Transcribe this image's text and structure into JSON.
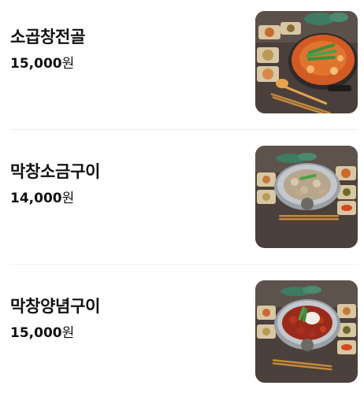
{
  "menu": {
    "items": [
      {
        "name": "소곱창전골",
        "price": "15,000",
        "currency": "원",
        "photo": "gopchang-jeongol-photo"
      },
      {
        "name": "막창소금구이",
        "price": "14,000",
        "currency": "원",
        "photo": "makchang-salt-grill-photo"
      },
      {
        "name": "막창양념구이",
        "price": "15,000",
        "currency": "원",
        "photo": "makchang-seasoned-grill-photo"
      }
    ]
  }
}
